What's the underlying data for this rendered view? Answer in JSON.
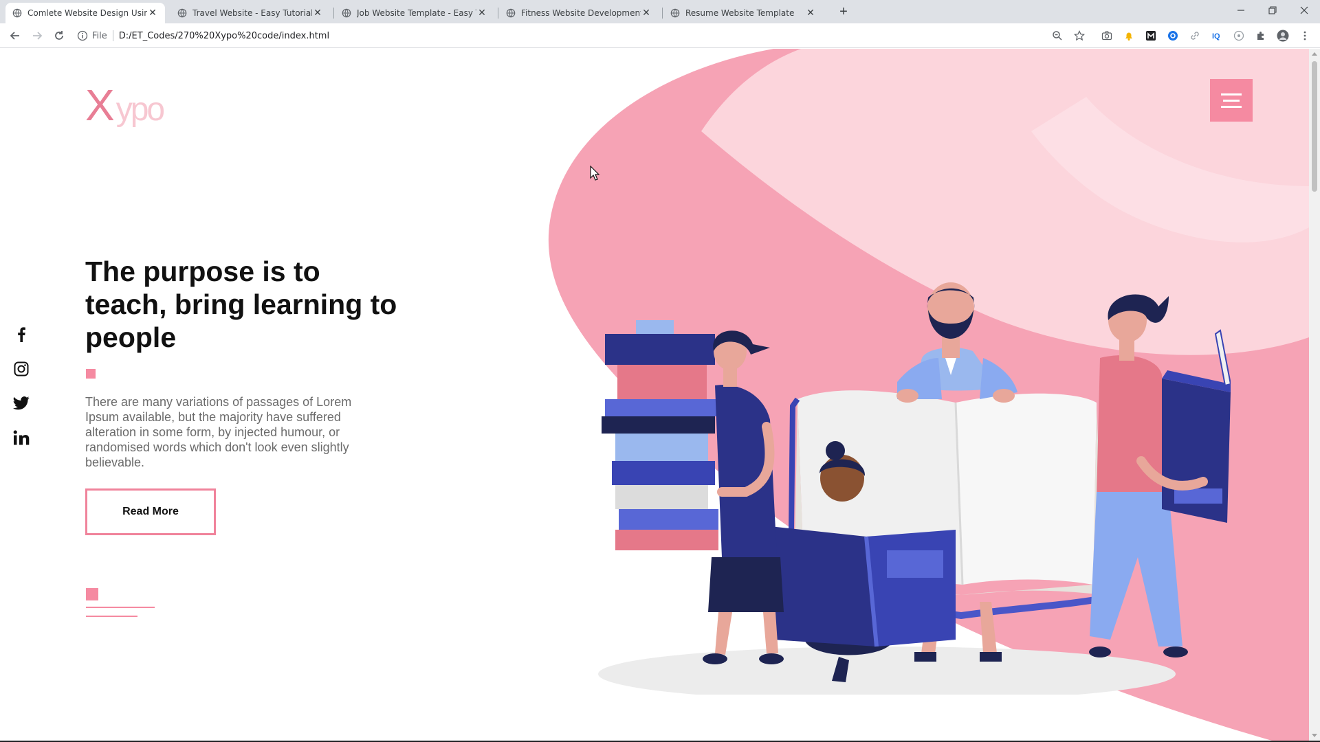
{
  "browser": {
    "tabs": [
      {
        "title": "Comlete Website Design Using H",
        "active": true
      },
      {
        "title": "Travel Website - Easy Tutorials",
        "active": false
      },
      {
        "title": "Job Website Template - Easy Tuto",
        "active": false
      },
      {
        "title": "Fitness Website Development",
        "active": false
      },
      {
        "title": "Resume Website Template",
        "active": false
      }
    ],
    "new_tab_label": "+",
    "address": {
      "scheme": "File",
      "url": "D:/ET_Codes/270%20Xypo%20code/index.html"
    }
  },
  "site": {
    "logo": {
      "first": "X",
      "rest": "ypo"
    },
    "headline": "The purpose is to teach, bring learning to people",
    "description": "There are many variations of passages of Lorem Ipsum available, but the majority have suffered alteration in some form, by injected humour, or randomised words which don't look even slightly believable.",
    "cta_label": "Read More",
    "social": [
      {
        "icon": "facebook-icon",
        "glyph": "f"
      },
      {
        "icon": "instagram-icon"
      },
      {
        "icon": "twitter-icon"
      },
      {
        "icon": "linkedin-icon",
        "glyph": "in"
      }
    ]
  },
  "colors": {
    "accent": "#f58aa1",
    "blob_light": "#fdd5dc",
    "blob_dark": "#f69fb2",
    "navy": "#2b3288",
    "logo_light": "#f7c7d1"
  }
}
